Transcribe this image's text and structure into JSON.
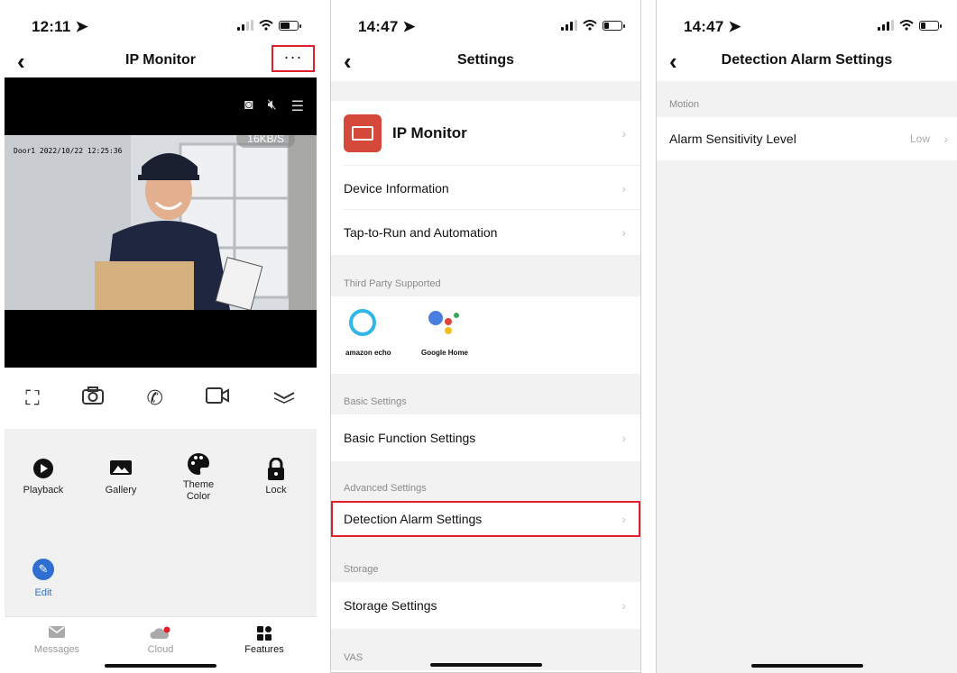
{
  "phone1": {
    "status": {
      "time": "12:11 ➤"
    },
    "nav": {
      "back": "‹",
      "title": "IP Monitor",
      "more": "···"
    },
    "video": {
      "tools": [
        "camera-icon",
        "mute-icon",
        "layout-icon"
      ],
      "osd": "Door1 2022/10/22 12:25:36",
      "speed": "16KB/S"
    },
    "controls": [
      "fullscreen-icon",
      "snapshot-icon",
      "call-icon",
      "record-icon",
      "expand-icon"
    ],
    "features": [
      {
        "label": "Playback",
        "icon": "play-icon"
      },
      {
        "label": "Gallery",
        "icon": "gallery-icon"
      },
      {
        "label": "Theme\nColor",
        "icon": "palette-icon"
      },
      {
        "label": "Lock",
        "icon": "lock-icon"
      }
    ],
    "edit": {
      "label": "Edit"
    },
    "tabs": [
      {
        "label": "Messages",
        "icon": "mail-icon"
      },
      {
        "label": "Cloud",
        "icon": "cloud-icon"
      },
      {
        "label": "Features",
        "icon": "grid-icon"
      }
    ]
  },
  "phone2": {
    "status": {
      "time": "14:47 ➤"
    },
    "nav": {
      "back": "‹",
      "title": "Settings"
    },
    "device": {
      "name": "IP Monitor"
    },
    "rows_top": [
      "Device Information",
      "Tap-to-Run and Automation"
    ],
    "third_party": {
      "label": "Third Party Supported",
      "alexa": "amazon echo",
      "google": "Google Home"
    },
    "basic": {
      "label": "Basic Settings",
      "row": "Basic Function Settings"
    },
    "advanced": {
      "label": "Advanced Settings",
      "row": "Detection Alarm Settings"
    },
    "storage": {
      "label": "Storage",
      "row": "Storage Settings"
    },
    "vas": {
      "label": "VAS"
    }
  },
  "phone3": {
    "status": {
      "time": "14:47 ➤"
    },
    "nav": {
      "back": "‹",
      "title": "Detection Alarm Settings"
    },
    "section": "Motion",
    "row": {
      "label": "Alarm Sensitivity Level",
      "value": "Low"
    }
  },
  "colors": {
    "highlight": "#e0202a",
    "brand_red": "#d4493a",
    "edit_blue": "#2f6fd1",
    "alexa_blue": "#31b6e8"
  }
}
